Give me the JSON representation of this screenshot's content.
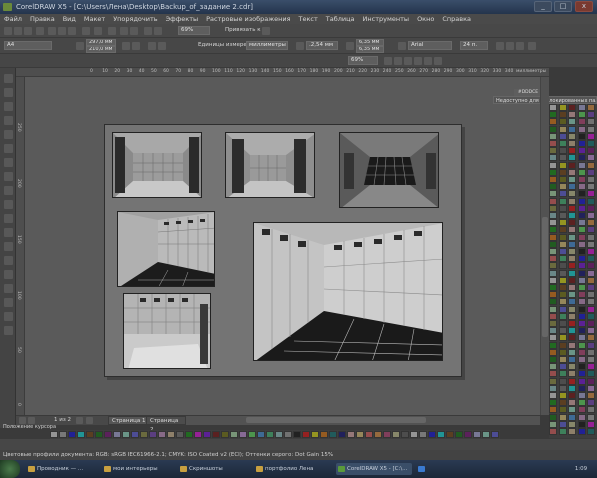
{
  "window": {
    "title": "CorelDRAW X5 - [C:\\Users\\Лена\\Desktop\\Backup_of_задание 2.cdr]",
    "controls": [
      "_",
      "□",
      "x"
    ]
  },
  "menu": [
    "Файл",
    "Правка",
    "Вид",
    "Макет",
    "Упорядочить",
    "Эффекты",
    "Растровые изображения",
    "Текст",
    "Таблица",
    "Инструменты",
    "Окно",
    "Справка"
  ],
  "standard_toolbar": {
    "zoom": "69%",
    "snap_label": "Привязать к"
  },
  "property_bar": {
    "paper": "A4",
    "width": "297,0 мм",
    "height": "210,0 мм",
    "units_label": "Единицы измерения:",
    "units_value": "миллиметры",
    "nudge": ".2,54 мм",
    "dup_x": "6,35 мм",
    "dup_y": "6,35 мм"
  },
  "text_toolbar": {
    "font": "Arial",
    "size": "24 п.",
    "zoom2": "69%"
  },
  "rulers": {
    "h_ticks": [
      "0",
      "10",
      "20",
      "30",
      "40",
      "50",
      "60",
      "70",
      "80",
      "90",
      "100",
      "110",
      "120",
      "130",
      "140",
      "150",
      "160",
      "170",
      "180",
      "190",
      "200",
      "210",
      "220",
      "230",
      "240",
      "250",
      "260",
      "270",
      "280",
      "290",
      "300",
      "310",
      "320",
      "330",
      "340"
    ],
    "h_units": "миллиметры",
    "v_ticks": [
      "250",
      "200",
      "150",
      "100",
      "50",
      "0"
    ]
  },
  "docker": {
    "color_code": "#DDDCE",
    "tooltip": "Недоступно для заблокированных палитр"
  },
  "page_nav": {
    "position": "1 из 2",
    "tabs": [
      "Страница 1",
      "Страница 2"
    ]
  },
  "status": {
    "cursor": "Положение курсора",
    "profile": "Цветовые профили документа: RGB: sRGB IEC61966-2.1; CMYK: ISO Coated v2 (ECI); Оттенки серого: Dot Gain 15%"
  },
  "taskbar": {
    "items": [
      {
        "label": "Проводник — ...",
        "color": "#c8a040"
      },
      {
        "label": "мои интерьеры",
        "color": "#c8a040"
      },
      {
        "label": "Скриншоты",
        "color": "#c8a040"
      },
      {
        "label": "портфолио Лена",
        "color": "#c8a040"
      },
      {
        "label": "CorelDRAW X5 - [C:\\...",
        "color": "#5a9a3a"
      },
      {
        "label": "",
        "color": "#3a7ad0"
      }
    ],
    "clock": "1:09"
  },
  "colors": {
    "accent": "#2a3a52",
    "palette": [
      "#ffffff",
      "#000000",
      "#7a7a7a",
      "#c0c0c0",
      "#ff0000",
      "#00a000",
      "#0000ff",
      "#ffff00",
      "#ff00ff",
      "#00ffff",
      "#ff8000",
      "#8000ff",
      "#804000",
      "#008080",
      "#800000",
      "#008000",
      "#000080",
      "#808000",
      "#800080",
      "#ffc0c0",
      "#c0ffc0",
      "#c0c0ff",
      "#ffe080",
      "#e0a0ff",
      "#a0ffe0",
      "#ff6060",
      "#60ff60",
      "#6060ff",
      "#ffa040",
      "#40a0ff",
      "#a0a040",
      "#d04080",
      "#40d080",
      "#8040d0",
      "#e0e0a0",
      "#a0e0e0",
      "#e0a0e0",
      "#606060",
      "#b0b0b0",
      "#f0d0a0"
    ]
  }
}
